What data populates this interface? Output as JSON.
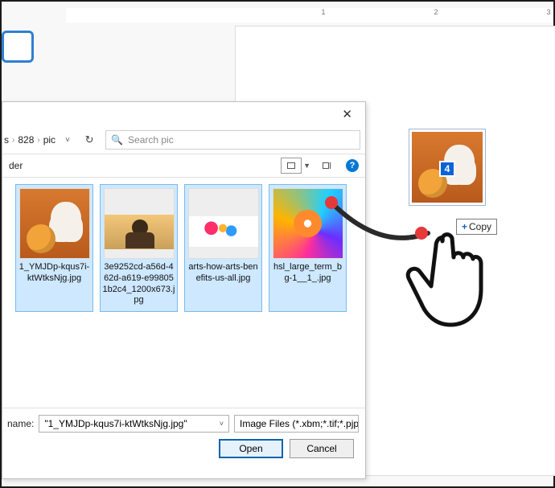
{
  "ruler": {
    "marks": [
      "1",
      "2",
      "3"
    ]
  },
  "dialog": {
    "breadcrumb": {
      "seg1": "828",
      "seg2": "pic"
    },
    "search_placeholder": "Search pic",
    "organize_label": "der",
    "help_label": "?",
    "files": [
      {
        "name": "1_YMJDp-kqus7i-ktWtksNjg.jpg",
        "selected": true,
        "art": "dog"
      },
      {
        "name": "3e9252cd-a56d-462d-a619-e998051b2c4_1200x673.jpg",
        "selected": true,
        "art": "people"
      },
      {
        "name": "arts-how-arts-benefits-us-all.jpg",
        "selected": true,
        "art": "arts"
      },
      {
        "name": "hsl_large_term_bg-1__1_.jpg",
        "selected": true,
        "art": "swirl"
      }
    ],
    "filename_label": "name:",
    "filename_value": "\"1_YMJDp-kqus7i-ktWtksNjg.jpg\"",
    "filter_value": "Image Files (*.xbm;*.tif;*.pjp;*.a",
    "open_label": "Open",
    "cancel_label": "Cancel"
  },
  "drop": {
    "badge": "4"
  },
  "copy_tag": {
    "plus": "+",
    "label": "Copy"
  }
}
